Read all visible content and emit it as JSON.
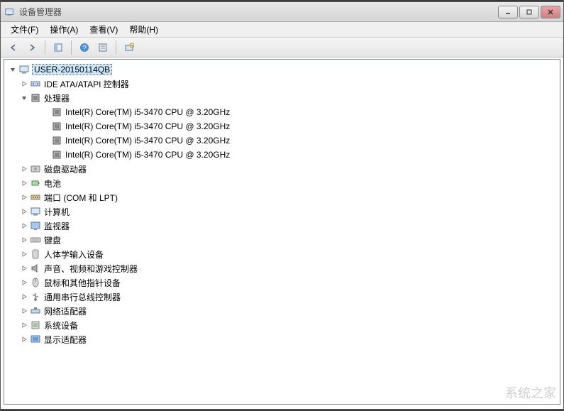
{
  "window": {
    "title": "设备管理器"
  },
  "menus": {
    "file": "文件(F)",
    "action": "操作(A)",
    "view": "查看(V)",
    "help": "帮助(H)"
  },
  "tree": {
    "root": "USER-20150114QB",
    "nodes": [
      {
        "label": "IDE ATA/ATAPI 控制器",
        "icon": "controller",
        "expanded": false
      },
      {
        "label": "处理器",
        "icon": "cpu",
        "expanded": true,
        "children": [
          {
            "label": "Intel(R) Core(TM) i5-3470 CPU @ 3.20GHz",
            "icon": "cpu"
          },
          {
            "label": "Intel(R) Core(TM) i5-3470 CPU @ 3.20GHz",
            "icon": "cpu"
          },
          {
            "label": "Intel(R) Core(TM) i5-3470 CPU @ 3.20GHz",
            "icon": "cpu"
          },
          {
            "label": "Intel(R) Core(TM) i5-3470 CPU @ 3.20GHz",
            "icon": "cpu"
          }
        ]
      },
      {
        "label": "磁盘驱动器",
        "icon": "disk",
        "expanded": false
      },
      {
        "label": "电池",
        "icon": "battery",
        "expanded": false
      },
      {
        "label": "端口 (COM 和 LPT)",
        "icon": "port",
        "expanded": false
      },
      {
        "label": "计算机",
        "icon": "computer",
        "expanded": false
      },
      {
        "label": "监视器",
        "icon": "monitor",
        "expanded": false
      },
      {
        "label": "键盘",
        "icon": "keyboard",
        "expanded": false
      },
      {
        "label": "人体学输入设备",
        "icon": "hid",
        "expanded": false
      },
      {
        "label": "声音、视频和游戏控制器",
        "icon": "sound",
        "expanded": false
      },
      {
        "label": "鼠标和其他指针设备",
        "icon": "mouse",
        "expanded": false
      },
      {
        "label": "通用串行总线控制器",
        "icon": "usb",
        "expanded": false
      },
      {
        "label": "网络适配器",
        "icon": "network",
        "expanded": false
      },
      {
        "label": "系统设备",
        "icon": "system",
        "expanded": false
      },
      {
        "label": "显示适配器",
        "icon": "display",
        "expanded": false
      }
    ]
  },
  "watermark": "系统之家"
}
